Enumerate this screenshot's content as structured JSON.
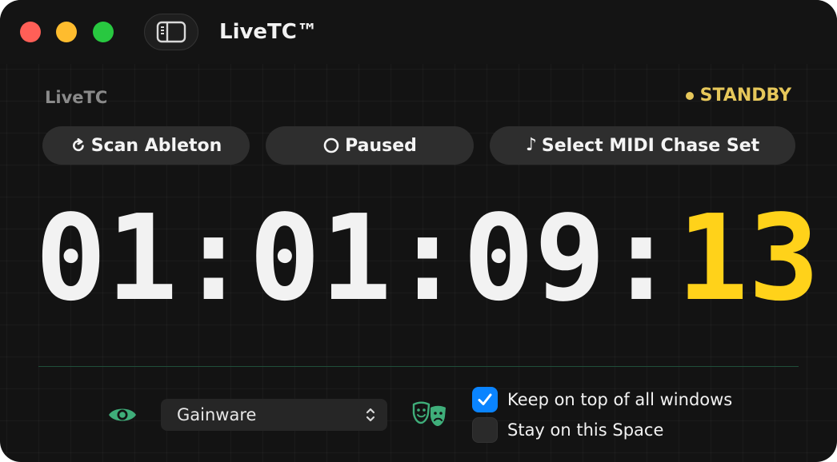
{
  "window": {
    "title": "LiveTC™",
    "controls": [
      "close",
      "minimize",
      "zoom"
    ],
    "sidebar_toggle_icon": "sidebar-icon"
  },
  "header": {
    "app_label": "LiveTC",
    "status": "STANDBY",
    "status_color": "#e6c75a"
  },
  "buttons": {
    "scan": {
      "label": "Scan Ableton",
      "icon": "refresh-icon"
    },
    "paused": {
      "label": "Paused",
      "icon": "circle-icon"
    },
    "midi": {
      "label": "Select MIDI Chase Set",
      "icon": "music-note-icon",
      "icon_glyph": "♪"
    }
  },
  "timecode": {
    "hours": "01",
    "minutes": "01",
    "seconds": "09",
    "frames": "13",
    "separator": ":",
    "frames_color": "#ffd21a"
  },
  "footer": {
    "visibility_icon": "eye-icon",
    "selector_value": "Gainware",
    "theater_icon": "theater-masks-icon",
    "keep_on_top": {
      "label": "Keep on top of all windows",
      "checked": true
    },
    "stay_on_space": {
      "label": "Stay on this Space",
      "checked": false
    }
  },
  "colors": {
    "accent_green": "#3fae7a",
    "checkbox_blue": "#0a84ff"
  }
}
